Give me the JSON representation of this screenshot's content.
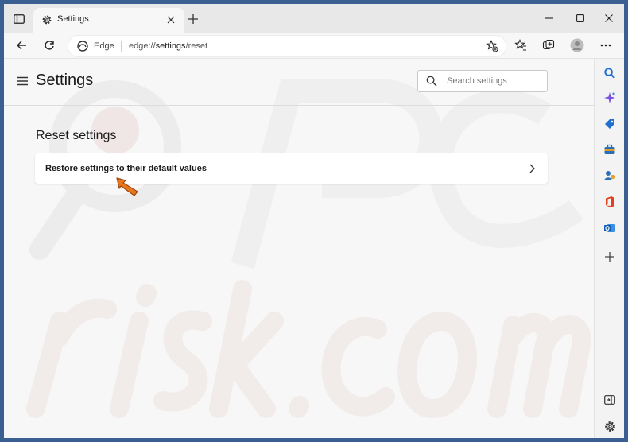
{
  "tab": {
    "title": "Settings"
  },
  "address": {
    "scheme_label": "Edge",
    "url_prefix": "edge://",
    "url_path": "settings",
    "url_rest": "/reset"
  },
  "page": {
    "title": "Settings",
    "section_title": "Reset settings"
  },
  "search": {
    "placeholder": "Search settings"
  },
  "reset_card": {
    "label": "Restore settings to their default values"
  },
  "colors": {
    "accent": "#1f6fd0",
    "titlebar": "#e8e8e8",
    "content_bg": "#f7f7f7",
    "desktop": "#3a5f91",
    "cursor": "#e8761c"
  },
  "sidebar_icons": [
    "search-icon",
    "copilot-icon",
    "shopping-tag-icon",
    "tools-icon",
    "games-icon",
    "office-icon",
    "outlook-icon",
    "add-icon"
  ],
  "sidebar_bottom_icons": [
    "hide-sidebar-icon",
    "settings-gear-icon"
  ]
}
